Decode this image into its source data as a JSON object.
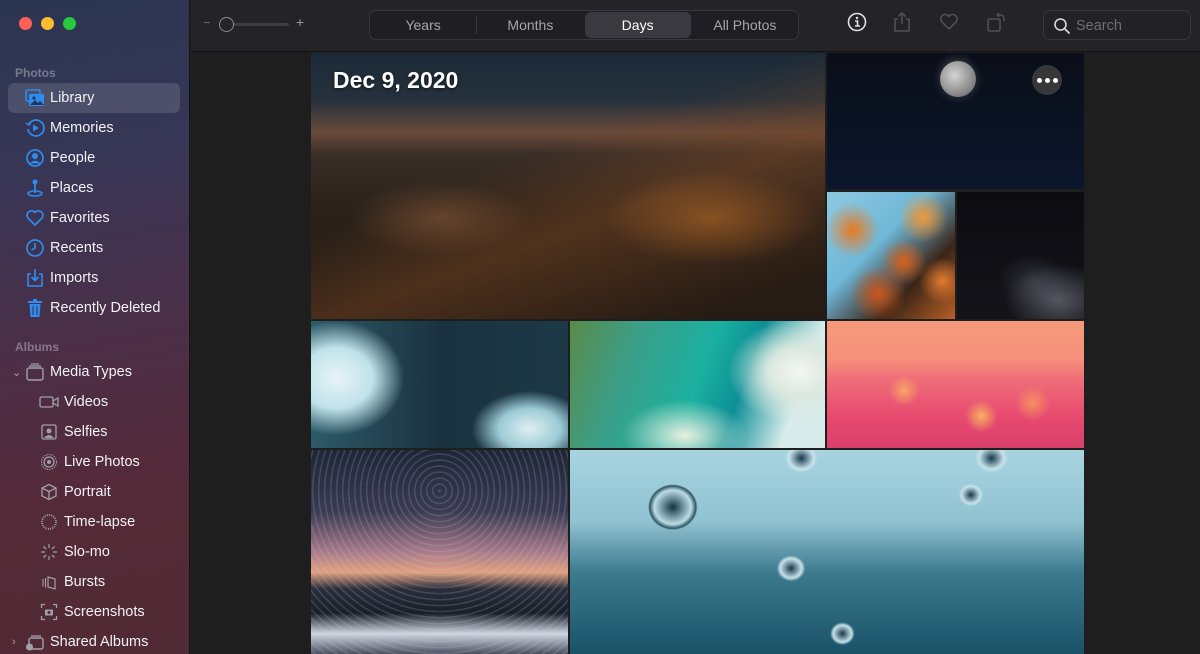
{
  "window": {
    "traffic_lights": [
      "close",
      "minimize",
      "zoom"
    ]
  },
  "sidebar": {
    "photos_section": "Photos",
    "photos_items": [
      {
        "label": "Library",
        "icon": "photo-library-icon",
        "active": true
      },
      {
        "label": "Memories",
        "icon": "memories-icon"
      },
      {
        "label": "People",
        "icon": "person-circle-icon"
      },
      {
        "label": "Places",
        "icon": "map-pin-icon"
      },
      {
        "label": "Favorites",
        "icon": "heart-icon"
      },
      {
        "label": "Recents",
        "icon": "clock-icon"
      },
      {
        "label": "Imports",
        "icon": "import-icon"
      },
      {
        "label": "Recently Deleted",
        "icon": "trash-icon"
      }
    ],
    "albums_section": "Albums",
    "media_types": {
      "label": "Media Types",
      "expanded": true,
      "items": [
        {
          "label": "Videos",
          "icon": "video-camera-icon"
        },
        {
          "label": "Selfies",
          "icon": "selfie-icon"
        },
        {
          "label": "Live Photos",
          "icon": "live-photo-icon"
        },
        {
          "label": "Portrait",
          "icon": "cube-icon"
        },
        {
          "label": "Time-lapse",
          "icon": "timelapse-icon"
        },
        {
          "label": "Slo-mo",
          "icon": "slomo-icon"
        },
        {
          "label": "Bursts",
          "icon": "bursts-icon"
        },
        {
          "label": "Screenshots",
          "icon": "screenshot-icon"
        }
      ]
    },
    "shared_albums": {
      "label": "Shared Albums",
      "expanded": false
    }
  },
  "toolbar": {
    "zoom_minus": "−",
    "zoom_plus": "+",
    "zoom_level": 0.0,
    "view_tabs": [
      {
        "label": "Years"
      },
      {
        "label": "Months"
      },
      {
        "label": "Days",
        "active": true
      },
      {
        "label": "All Photos"
      }
    ],
    "actions": [
      "info-icon",
      "share-icon",
      "favorite-icon",
      "rotate-icon"
    ],
    "search": {
      "placeholder": "Search",
      "value": ""
    }
  },
  "content": {
    "date_label": "Dec 9, 2020",
    "more_button": "more-options",
    "photos": [
      {
        "name": "mountain-photo",
        "subject": "mountain at dusk"
      },
      {
        "name": "moon-photo",
        "subject": "moon in night sky"
      },
      {
        "name": "leaves-photo",
        "subject": "autumn leaves"
      },
      {
        "name": "nebula-photo",
        "subject": "starry sky nebula"
      },
      {
        "name": "ocean-waves-photo",
        "subject": "ocean waves aerial"
      },
      {
        "name": "teal-wave-photo",
        "subject": "teal wave"
      },
      {
        "name": "pink-city-photo",
        "subject": "city lights pink sky"
      },
      {
        "name": "star-trails-photo",
        "subject": "star trails over mountains"
      },
      {
        "name": "water-drops-photo",
        "subject": "water droplets on glass"
      }
    ]
  }
}
